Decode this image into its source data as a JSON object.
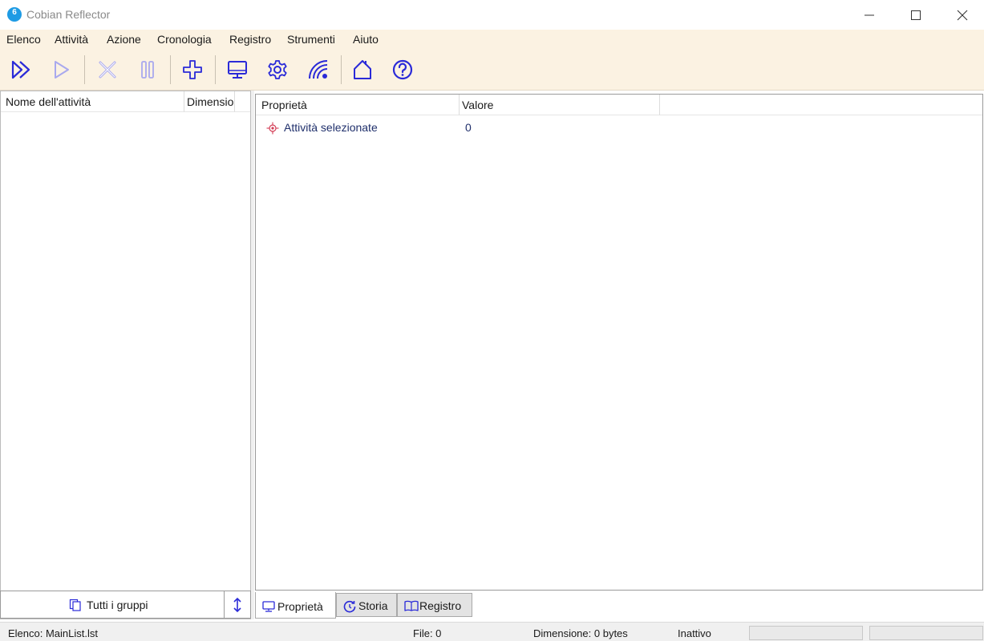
{
  "window": {
    "title": "Cobian Reflector",
    "icon_text": "6"
  },
  "menu": {
    "items": [
      "Elenco",
      "Attività",
      "Azione",
      "Cronologia",
      "Registro",
      "Strumenti",
      "Aiuto"
    ]
  },
  "toolbar": {
    "buttons": [
      {
        "name": "run-all-icon",
        "enabled": true
      },
      {
        "name": "run-selected-icon",
        "enabled": false
      },
      {
        "name": "stop-icon",
        "enabled": false
      },
      {
        "name": "pause-icon",
        "enabled": false
      },
      {
        "name": "add-task-icon",
        "enabled": true
      },
      {
        "name": "monitor-icon",
        "enabled": true
      },
      {
        "name": "settings-gear-icon",
        "enabled": true
      },
      {
        "name": "remote-wifi-icon",
        "enabled": true
      },
      {
        "name": "home-icon",
        "enabled": true
      },
      {
        "name": "help-icon",
        "enabled": true
      }
    ]
  },
  "task_list": {
    "columns": [
      "Nome dell'attività",
      "Dimensio"
    ],
    "rows": []
  },
  "groups_button": {
    "label": "Tutti i gruppi"
  },
  "properties": {
    "columns": [
      "Proprietà",
      "Valore"
    ],
    "rows": [
      {
        "name": "Attività selezionate",
        "value": "0"
      }
    ]
  },
  "tabs": [
    {
      "label": "Proprietà",
      "active": true
    },
    {
      "label": "Storia",
      "active": false
    },
    {
      "label": "Registro",
      "active": false
    }
  ],
  "status": {
    "list": "Elenco: MainList.lst",
    "files": "File: 0",
    "size": "Dimensione: 0 bytes",
    "state": "Inattivo"
  },
  "colors": {
    "accent_blue": "#2a2ad8",
    "disabled_blue": "#a9a9ee",
    "toolbar_bg": "#fbf2e2",
    "app_icon": "#1e9be4"
  }
}
